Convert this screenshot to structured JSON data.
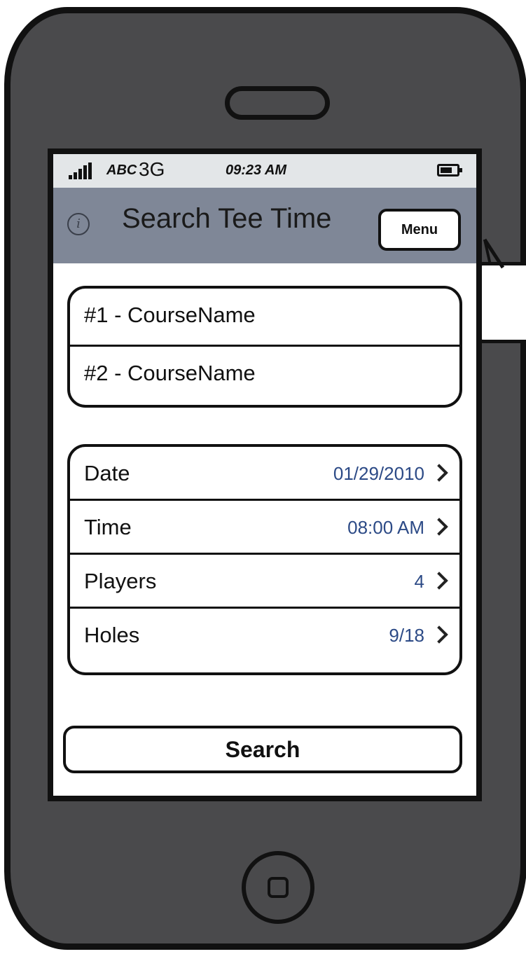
{
  "status_bar": {
    "carrier": "ABC",
    "network": "3G",
    "time": "09:23 AM"
  },
  "nav_bar": {
    "title": "Search Tee Time",
    "menu_label": "Menu"
  },
  "courses": [
    {
      "label": "#1 - CourseName"
    },
    {
      "label": "#2 - CourseName"
    }
  ],
  "params": [
    {
      "label": "Date",
      "value": "01/29/2010"
    },
    {
      "label": "Time",
      "value": "08:00 AM"
    },
    {
      "label": "Players",
      "value": "4"
    },
    {
      "label": "Holes",
      "value": "9/18"
    }
  ],
  "search_label": "Search",
  "colors": {
    "nav_bar": "#7f8797",
    "value_text": "#2c4a86",
    "device_body": "#4a4a4c"
  }
}
